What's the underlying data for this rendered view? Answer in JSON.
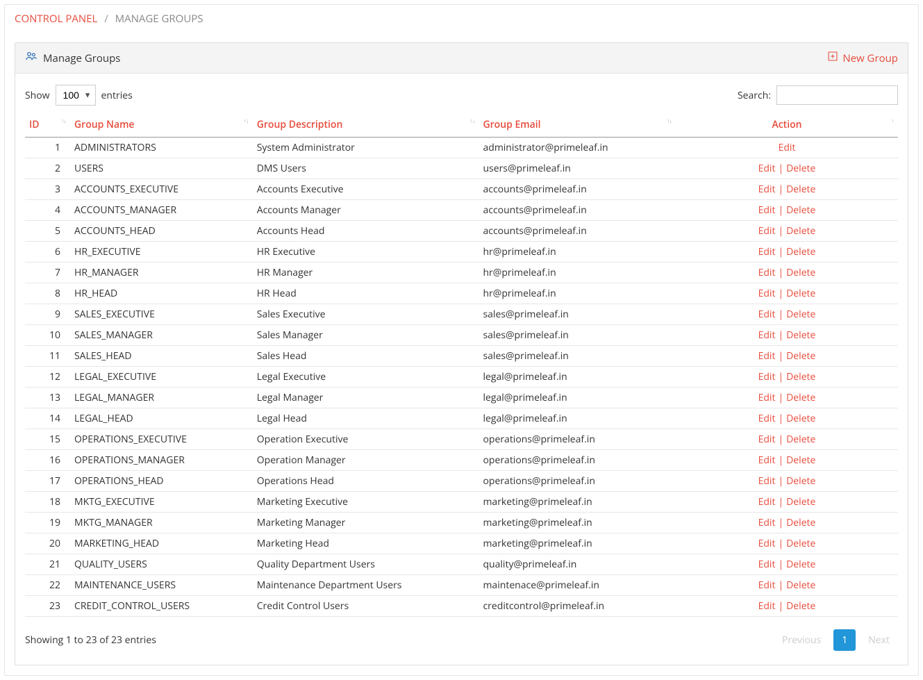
{
  "breadcrumb": {
    "root": "CONTROL PANEL",
    "sep": "/",
    "current": "MANAGE GROUPS"
  },
  "panel": {
    "title": "Manage Groups",
    "new_group": "New Group"
  },
  "length": {
    "show": "Show",
    "value": "100",
    "entries": "entries"
  },
  "search": {
    "label": "Search:",
    "value": ""
  },
  "columns": {
    "id": "ID",
    "name": "Group Name",
    "desc": "Group Description",
    "email": "Group Email",
    "action": "Action"
  },
  "action_labels": {
    "edit": "Edit",
    "delete": "Delete"
  },
  "rows": [
    {
      "id": "1",
      "name": "ADMINISTRATORS",
      "desc": "System Administrator",
      "email": "administrator@primeleaf.in",
      "deletable": false
    },
    {
      "id": "2",
      "name": "USERS",
      "desc": "DMS Users",
      "email": "users@primeleaf.in",
      "deletable": true
    },
    {
      "id": "3",
      "name": "ACCOUNTS_EXECUTIVE",
      "desc": "Accounts Executive",
      "email": "accounts@primeleaf.in",
      "deletable": true
    },
    {
      "id": "4",
      "name": "ACCOUNTS_MANAGER",
      "desc": "Accounts Manager",
      "email": "accounts@primeleaf.in",
      "deletable": true
    },
    {
      "id": "5",
      "name": "ACCOUNTS_HEAD",
      "desc": "Accounts Head",
      "email": "accounts@primeleaf.in",
      "deletable": true
    },
    {
      "id": "6",
      "name": "HR_EXECUTIVE",
      "desc": "HR Executive",
      "email": "hr@primeleaf.in",
      "deletable": true
    },
    {
      "id": "7",
      "name": "HR_MANAGER",
      "desc": "HR Manager",
      "email": "hr@primeleaf.in",
      "deletable": true
    },
    {
      "id": "8",
      "name": "HR_HEAD",
      "desc": "HR Head",
      "email": "hr@primeleaf.in",
      "deletable": true
    },
    {
      "id": "9",
      "name": "SALES_EXECUTIVE",
      "desc": "Sales Executive",
      "email": "sales@primeleaf.in",
      "deletable": true
    },
    {
      "id": "10",
      "name": "SALES_MANAGER",
      "desc": "Sales Manager",
      "email": "sales@primeleaf.in",
      "deletable": true
    },
    {
      "id": "11",
      "name": "SALES_HEAD",
      "desc": "Sales Head",
      "email": "sales@primeleaf.in",
      "deletable": true
    },
    {
      "id": "12",
      "name": "LEGAL_EXECUTIVE",
      "desc": "Legal Executive",
      "email": "legal@primeleaf.in",
      "deletable": true
    },
    {
      "id": "13",
      "name": "LEGAL_MANAGER",
      "desc": "Legal Manager",
      "email": "legal@primeleaf.in",
      "deletable": true
    },
    {
      "id": "14",
      "name": "LEGAL_HEAD",
      "desc": "Legal Head",
      "email": "legal@primeleaf.in",
      "deletable": true
    },
    {
      "id": "15",
      "name": "OPERATIONS_EXECUTIVE",
      "desc": "Operation Executive",
      "email": "operations@primeleaf.in",
      "deletable": true
    },
    {
      "id": "16",
      "name": "OPERATIONS_MANAGER",
      "desc": "Operation Manager",
      "email": "operations@primeleaf.in",
      "deletable": true
    },
    {
      "id": "17",
      "name": "OPERATIONS_HEAD",
      "desc": "Operations Head",
      "email": "operations@primeleaf.in",
      "deletable": true
    },
    {
      "id": "18",
      "name": "MKTG_EXECUTIVE",
      "desc": "Marketing Executive",
      "email": "marketing@primeleaf.in",
      "deletable": true
    },
    {
      "id": "19",
      "name": "MKTG_MANAGER",
      "desc": "Marketing Manager",
      "email": "marketing@primeleaf.in",
      "deletable": true
    },
    {
      "id": "20",
      "name": "MARKETING_HEAD",
      "desc": "Marketing Head",
      "email": "marketing@primeleaf.in",
      "deletable": true
    },
    {
      "id": "21",
      "name": "QUALITY_USERS",
      "desc": "Quality Department Users",
      "email": "quality@primeleaf.in",
      "deletable": true
    },
    {
      "id": "22",
      "name": "MAINTENANCE_USERS",
      "desc": "Maintenance Department Users",
      "email": "maintenace@primeleaf.in",
      "deletable": true
    },
    {
      "id": "23",
      "name": "CREDIT_CONTROL_USERS",
      "desc": "Credit Control Users",
      "email": "creditcontrol@primeleaf.in",
      "deletable": true
    }
  ],
  "footer": {
    "info": "Showing 1 to 23 of 23 entries",
    "prev": "Previous",
    "page": "1",
    "next": "Next"
  }
}
